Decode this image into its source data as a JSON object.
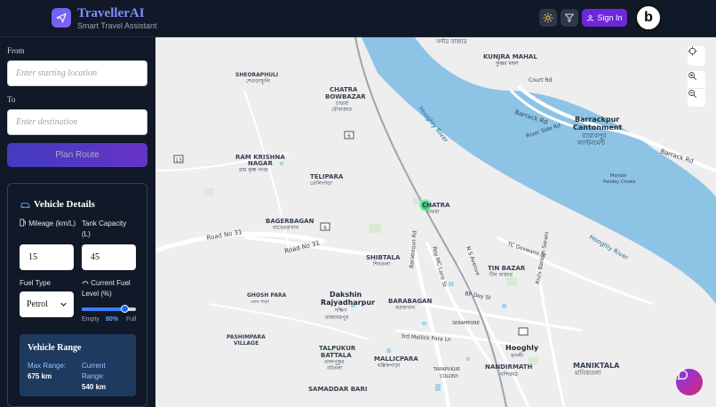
{
  "header": {
    "brand": "TravellerAI",
    "tagline": "Smart Travel Assistant",
    "signin_label": "Sign In",
    "badge_letter": "b"
  },
  "form": {
    "from_label": "From",
    "from_placeholder": "Enter starting location",
    "to_label": "To",
    "to_placeholder": "Enter destination",
    "plan_label": "Plan Route"
  },
  "vehicle": {
    "title": "Vehicle Details",
    "mileage_label": "Mileage (km/L)",
    "mileage_value": "15",
    "tank_label": "Tank Capacity (L)",
    "tank_value": "45",
    "fuel_type_label": "Fuel Type",
    "fuel_type_value": "Petrol",
    "fuel_level_label": "Current Fuel Level (%)",
    "fuel_level_value": 0.8,
    "empty_label": "Empty",
    "level_text": "80%",
    "full_label": "Full",
    "range_title": "Vehicle Range",
    "max_range_label": "Max Range:",
    "max_range_value": "675 km",
    "current_range_label": "Current Range:",
    "current_range_value": "540 km"
  },
  "map": {
    "labels": {
      "kunjra": "KUNJRA MAHAL",
      "kunjra_bn": "কুঞ্জর মহল",
      "sardar": "সর্দার বাজার",
      "court_rd": "Court Rd",
      "barrack_rd": "Barrack Rd",
      "barrackpur": "Barrackpur",
      "cantonment": "Cantonment",
      "barrackpur_bn": "ব্যারাকপুর",
      "cantonment_bn": "ক্যান্টনমেন্ট",
      "river_side": "River Side Rd",
      "barrack_rd2": "Barrack Rd",
      "mandal": "Mandal",
      "pandey": "Pandey Chowk",
      "hooghly_river": "Hooghly River",
      "hooghly_river2": "Hooghly River",
      "sheorafuli": "SHEORAPHULI",
      "sheorafuli_bn": "শেওড়াফুলি",
      "chatra_bowbazar": "CHATRA",
      "bowbazar": "BOWBAZAR",
      "chatra_bow_bn": "চাতরা",
      "bowbazar_bn": "বৌবাজার",
      "ram_krishna": "RAM KRISHNA",
      "nagar": "NAGAR",
      "ram_krishna_bn": "রাম কৃষ্ণ নগর",
      "telipara": "TELIPARA",
      "telipara_bn": "তেলিপাড়া",
      "bagerbagan": "BAGERBAGAN",
      "bagerbagan_bn": "বাগেরবাগান",
      "road31": "Road No 31",
      "road31b": "Road No 31",
      "chatra": "CHATRA",
      "chatra_bn": "চাতরা",
      "shibtala": "SHIBTALA",
      "shibtala_bn": "শিবতলা",
      "tc_goswami": "TC Goswami St",
      "tin_bazar": "TIN BAZAR",
      "tin_bazar_bn": "টিন বাজার",
      "dakshin": "Dakshin",
      "rajyadharpur": "Rajyadharpur",
      "dakshin_bn": "দক্ষিণ",
      "rajya_bn": "রাজ্যধরপুর",
      "barabagan": "BARABAGAN",
      "barabagan_bn": "বড়বাগান",
      "ghosh_para": "GHOSH PARA",
      "ghosh_para_bn": "ঘোষ পাড়া",
      "bp_dey": "BP Dey St",
      "serampore": "SERAMPORE",
      "pashimpara": "PASHIMPARA",
      "village": "VILLAGE",
      "talpukur": "TALPUKUR",
      "battala": "BATTALA",
      "talpukur_bn": "তালপুকুর",
      "battala_bn": "বটতলা",
      "mallick": "3rd Mallick Para Ln",
      "mallicpara": "MALLICPARA",
      "mallicpara_bn": "মল্লিকপাড়া",
      "hooghly": "Hooghly",
      "hooghly_bn": "হুগলী",
      "nandirmath": "NANDIRMATH",
      "nandirmath_bn": "নন্দিরমঠ",
      "maniktala": "MANIKTALA",
      "maniktala_bn": "মানিকতলা",
      "tarapukur": "TARAPUKUR",
      "colony": "COLONY",
      "samaddar": "SAMADDAR BARI",
      "barabagan_rd": "Barabagan Rd",
      "roy_mc": "Roy MC Lane St",
      "ns_avenue": "N S Avenue",
      "rishi": "Rishi Bankim Sarani",
      "b6": "6",
      "b13": "13",
      "b6b": "6"
    }
  }
}
